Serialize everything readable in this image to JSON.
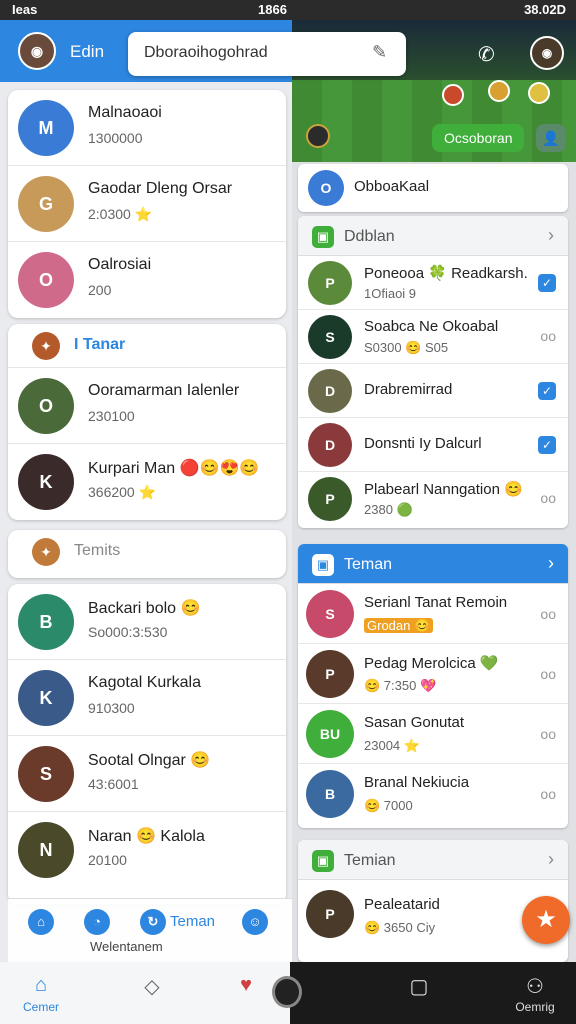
{
  "status": {
    "left": "Ieas",
    "center": "1866",
    "right": "38.02D"
  },
  "header": {
    "title": "Edin",
    "search_value": "Dboraoihogohrad"
  },
  "game": {
    "button": "Ocsoboran"
  },
  "left": {
    "card1": [
      {
        "name": "Malnaoaoi",
        "sub": "1300000",
        "initial": "M",
        "color": "#3a7bd5"
      },
      {
        "name": "Gaodar Dleng Orsar",
        "sub": "2:0300 ⭐",
        "initial": "G",
        "color": "#c89a5a"
      },
      {
        "name": "Oalrosiai",
        "sub": "200",
        "initial": "O",
        "color": "#d06a8a"
      }
    ],
    "section1": "I Tanar",
    "card2": [
      {
        "name": "Ooramarman Ialenler",
        "sub": "230100",
        "initial": "O",
        "color": "#4a6a3a"
      },
      {
        "name": "Kurpari Man 🔴😊😍😊",
        "sub": "366200 ⭐",
        "initial": "K",
        "color": "#3a2a2a"
      }
    ],
    "section2": "Temits",
    "card3": [
      {
        "name": "Backari bolo 😊",
        "sub": "So000:3:530",
        "initial": "B",
        "color": "#2a8a6a"
      },
      {
        "name": "Kagotal Kurkala",
        "sub": "910300",
        "initial": "K",
        "color": "#3a5a8a"
      },
      {
        "name": "Sootal Olngar 😊",
        "sub": "43:6001",
        "initial": "S",
        "color": "#6a3a2a"
      },
      {
        "name": "Naran 😊 Kalola",
        "sub": "20100",
        "initial": "N",
        "color": "#4a4a2a"
      }
    ]
  },
  "overlay": {
    "label": "Welentanem",
    "text": "Teman"
  },
  "right": {
    "top_item": {
      "name": "ObboaKaal",
      "initial": "O"
    },
    "section_a": "Ddblan",
    "items_a": [
      {
        "name": "Poneooa 🍀 Readkarsh.",
        "sub": "1Ofiaoi 9",
        "initial": "P",
        "color": "#5a8a3a",
        "icon": "check"
      },
      {
        "name": "Soabca Ne Okoabal",
        "sub": "S0300 😊 S05",
        "initial": "S",
        "color": "#1a3a2a",
        "icon": "oo"
      },
      {
        "name": "Drabremirrad",
        "sub": "",
        "initial": "D",
        "color": "#6a6a4a",
        "icon": "check"
      },
      {
        "name": "Donsnti Iy Dalcurl",
        "sub": "",
        "initial": "D",
        "color": "#8a3a3a",
        "icon": "check"
      },
      {
        "name": "Plabearl Nanngation 😊",
        "sub": "2380 🟢",
        "initial": "P",
        "color": "#3a5a2a",
        "icon": "oo"
      }
    ],
    "section_b": "Teman",
    "items_b": [
      {
        "name": "Serianl Tanat Remoin",
        "sub": "Grodan 😊",
        "initial": "S",
        "color": "#c84a6a"
      },
      {
        "name": "Pedag Merolcica 💚",
        "sub": "😊 7:350 💖",
        "initial": "P",
        "color": "#5a3a2a"
      },
      {
        "name": "Sasan Gonutat",
        "sub": "23004 ⭐",
        "initial": "BU",
        "color": "#3fae3a"
      },
      {
        "name": "Branal Nekiucia",
        "sub": "😊 7000",
        "initial": "B",
        "color": "#3a6aa0"
      }
    ],
    "section_c": "Temian",
    "item_c": {
      "name": "Pealeatarid",
      "sub": "😊 3650 Ciy",
      "initial": "P",
      "color": "#4a3a2a"
    }
  },
  "nav": {
    "home_label": "Cemer",
    "profile_label": "Oemrig"
  }
}
